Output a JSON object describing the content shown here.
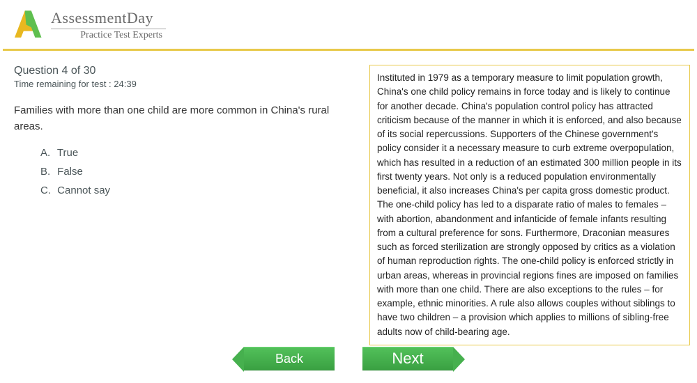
{
  "brand": {
    "name": "AssessmentDay",
    "tagline": "Practice Test Experts"
  },
  "question": {
    "counter": "Question 4 of 30",
    "timer": "Time remaining for test : 24:39",
    "text": "Families with more than one child are more common in China's rural areas.",
    "options": [
      {
        "letter": "A.",
        "label": "True"
      },
      {
        "letter": "B.",
        "label": "False"
      },
      {
        "letter": "C.",
        "label": "Cannot say"
      }
    ]
  },
  "passage": "Instituted in 1979 as a temporary measure to limit population growth, China's one child policy remains in force today and is likely to continue for another decade. China's population control policy has attracted criticism because of the manner in which it is enforced, and also because of its social repercussions. Supporters of the Chinese government's policy consider it a necessary measure to curb extreme overpopulation, which has resulted in a reduction of an estimated 300 million people in its first twenty years. Not only is a reduced population environmentally beneficial, it also increases China's per capita gross domestic product. The one-child policy has led to a disparate ratio of males to females – with abortion, abandonment and infanticide of female infants resulting from a cultural preference for sons. Furthermore, Draconian measures such as forced sterilization are strongly opposed by critics as a violation of human reproduction rights. The one-child policy is enforced strictly in urban areas, whereas in provincial regions fines are imposed on families with more than one child. There are also exceptions to the rules – for example, ethnic minorities. A rule also allows couples without siblings to have two children – a provision which applies to millions of sibling-free adults now of child-bearing age.",
  "nav": {
    "back": "Back",
    "next": "Next"
  }
}
